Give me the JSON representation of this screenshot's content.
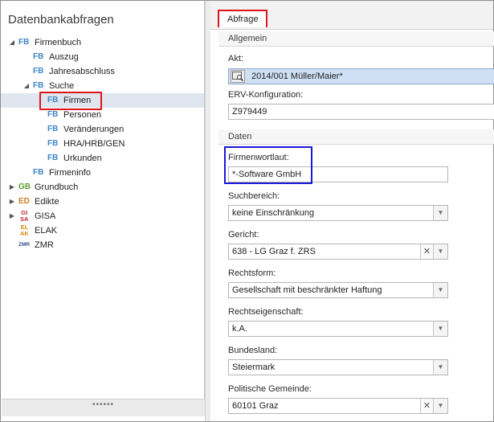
{
  "left": {
    "title": "Datenbankabfragen",
    "footer_grip": "••••••",
    "tree": [
      {
        "icon": "FB",
        "label": "Firmenbuch",
        "expander": "◢"
      },
      {
        "icon": "FB",
        "label": "Auszug"
      },
      {
        "icon": "FB",
        "label": "Jahresabschluss"
      },
      {
        "icon": "FB",
        "label": "Suche",
        "expander": "◢"
      },
      {
        "icon": "FB",
        "label": "Firmen"
      },
      {
        "icon": "FB",
        "label": "Personen"
      },
      {
        "icon": "FB",
        "label": "Veränderungen"
      },
      {
        "icon": "FB",
        "label": "HRA/HRB/GEN"
      },
      {
        "icon": "FB",
        "label": "Urkunden"
      },
      {
        "icon": "FB",
        "label": "Firmeninfo"
      },
      {
        "icon": "GB",
        "label": "Grundbuch",
        "expander": "▶"
      },
      {
        "icon": "ED",
        "label": "Edikte",
        "expander": "▶"
      },
      {
        "icon_top": "GI",
        "icon_bottom": "SA",
        "label": "GISA",
        "expander": "▶"
      },
      {
        "icon_top": "EL",
        "icon_bottom": "AK",
        "label": "ELAK"
      },
      {
        "icon": "ZMR",
        "label": "ZMR"
      }
    ]
  },
  "right": {
    "tab_label": "Abfrage",
    "group_allgemein": "Allgemein",
    "akt_label": "Akt:",
    "akt_value": "2014/001 Müller/Maier*",
    "erv_label": "ERV-Konfiguration:",
    "erv_value": "Z979449",
    "group_daten": "Daten",
    "firmenwortlaut_label": "Firmenwortlaut:",
    "firmenwortlaut_value": "*-Software GmbH",
    "suchbereich_label": "Suchbereich:",
    "suchbereich_value": "keine Einschränkung",
    "gericht_label": "Gericht:",
    "gericht_value": "638 - LG Graz f. ZRS",
    "rechtsform_label": "Rechtsform:",
    "rechtsform_value": "Gesellschaft mit beschränkter Haftung",
    "rechtseigenschaft_label": "Rechtseigenschaft:",
    "rechtseigenschaft_value": "k.A.",
    "bundesland_label": "Bundesland:",
    "bundesland_value": "Steiermark",
    "gemeinde_label": "Politische Gemeinde:",
    "gemeinde_value": "60101 Graz",
    "dropdown_glyph": "▼",
    "clear_glyph": "✕"
  }
}
